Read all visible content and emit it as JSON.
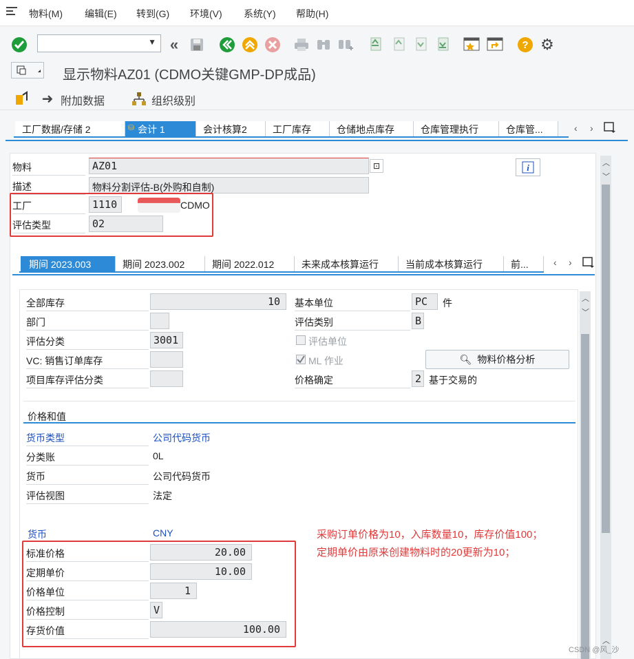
{
  "menu": {
    "items": [
      "物料(M)",
      "编辑(E)",
      "转到(G)",
      "环境(V)",
      "系统(Y)",
      "帮助(H)"
    ]
  },
  "title": "显示物料AZ01 (CDMO关键GMP-DP成品)",
  "appbar": {
    "additional_data": "附加数据",
    "org_levels": "组织级别"
  },
  "main_tabs": [
    "工厂数据/存储 2",
    "会计 1",
    "会计核算2",
    "工厂库存",
    "仓储地点库存",
    "仓库管理执行",
    "仓库管..."
  ],
  "header": {
    "material_label": "物料",
    "material_value": "AZ01",
    "desc_label": "描述",
    "desc_value": "物料分割评估-B(外购和自制)",
    "plant_label": "工厂",
    "plant_value": "1110",
    "plant_name": "CDMO",
    "valtype_label": "评估类型",
    "valtype_value": "02"
  },
  "period_tabs": [
    "期间 2023.003",
    "期间 2023.002",
    "期间 2022.012",
    "未来成本核算运行",
    "当前成本核算运行",
    "前..."
  ],
  "general": {
    "total_stock_label": "全部库存",
    "total_stock_value": "10",
    "division_label": "部门",
    "division_value": "",
    "val_class_label": "评估分类",
    "val_class_value": "3001",
    "vc_label": "VC: 销售订单库存",
    "vc_value": "",
    "project_label": "项目库存评估分类",
    "project_value": "",
    "base_unit_label": "基本单位",
    "base_unit_value": "PC",
    "base_unit_text": "件",
    "val_category_label": "评估类别",
    "val_category_value": "B",
    "val_unit_label": "评估单位",
    "ml_label": "ML 作业",
    "price_det_label": "价格确定",
    "price_det_value": "2",
    "price_det_text": "基于交易的",
    "price_analysis_button": "物料价格分析"
  },
  "prices": {
    "section_title": "价格和值",
    "currency_type_label": "货币类型",
    "currency_type_value": "公司代码货币",
    "ledger_label": "分类账",
    "ledger_value": "0L",
    "currency_label": "货币",
    "currency_value": "公司代码货币",
    "view_label": "评估视图",
    "view_value": "法定",
    "curr2_label": "货币",
    "curr2_value": "CNY",
    "std_price_label": "标准价格",
    "std_price_value": "20.00",
    "periodic_price_label": "定期单价",
    "periodic_price_value": "10.00",
    "price_unit_label": "价格单位",
    "price_unit_value": "1",
    "price_ctrl_label": "价格控制",
    "price_ctrl_value": "V",
    "inv_value_label": "存货价值",
    "inv_value_value": "100.00"
  },
  "annotation": {
    "line1": "采购订单价格为10，入库数量10，库存价值100；",
    "line2": "定期单价由原来创建物料时的20更新为10；"
  },
  "watermark": "CSDN @风_沙",
  "colors": {
    "accent": "#2d8ad6",
    "annotation": "#e03a3a",
    "ok_green": "#1f9d3a",
    "help_orange": "#f0a800"
  }
}
